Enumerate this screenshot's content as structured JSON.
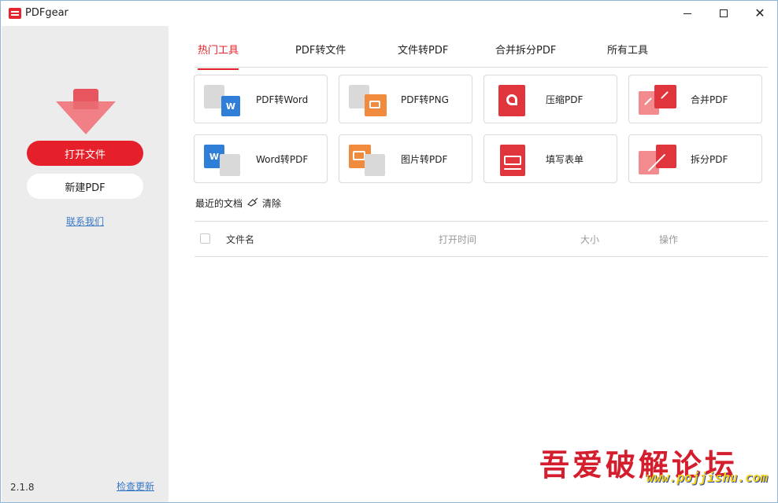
{
  "window": {
    "title": "PDFgear",
    "minimize": "—",
    "maximize": "□",
    "close": "✕"
  },
  "sidebar": {
    "open_file": "打开文件",
    "new_pdf": "新建PDF",
    "contact": "联系我们",
    "version": "2.1.8",
    "check_update": "检查更新"
  },
  "tabs": [
    {
      "label": "热门工具",
      "active": true
    },
    {
      "label": "PDF转文件",
      "active": false
    },
    {
      "label": "文件转PDF",
      "active": false
    },
    {
      "label": "合并拆分PDF",
      "active": false
    },
    {
      "label": "所有工具",
      "active": false
    }
  ],
  "tools": [
    {
      "label": "PDF转Word",
      "icon": "pdf-to-word-icon"
    },
    {
      "label": "PDF转PNG",
      "icon": "pdf-to-png-icon"
    },
    {
      "label": "压缩PDF",
      "icon": "compress-pdf-icon"
    },
    {
      "label": "合并PDF",
      "icon": "merge-pdf-icon"
    },
    {
      "label": "Word转PDF",
      "icon": "word-to-pdf-icon"
    },
    {
      "label": "图片转PDF",
      "icon": "image-to-pdf-icon"
    },
    {
      "label": "填写表单",
      "icon": "fill-form-icon"
    },
    {
      "label": "拆分PDF",
      "icon": "split-pdf-icon"
    }
  ],
  "recent": {
    "title": "最近的文档",
    "clear": "清除",
    "columns": {
      "name": "文件名",
      "open_time": "打开时间",
      "size": "大小",
      "action": "操作"
    }
  },
  "watermark": {
    "text": "吾爱破解论坛",
    "url": "www.pojjishu.com"
  },
  "colors": {
    "accent": "#e6202a",
    "sidebar_bg": "#ececec",
    "link": "#3a78c6"
  }
}
